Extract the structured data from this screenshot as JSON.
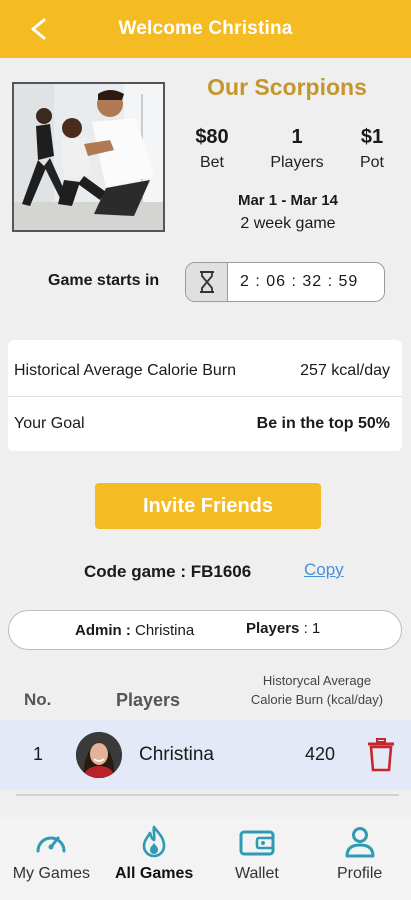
{
  "header": {
    "title": "Welcome Christina",
    "back_icon": "chevron-left-icon"
  },
  "game": {
    "title": "Our Scorpions",
    "stats": [
      {
        "value": "$80",
        "label": "Bet"
      },
      {
        "value": "1",
        "label": "Players"
      },
      {
        "value": "$1",
        "label": "Pot"
      }
    ],
    "dates": "Mar 1 - Mar 14",
    "duration": "2 week game",
    "starts_label": "Game starts in",
    "countdown": "2 : 06 : 32 : 59"
  },
  "info": {
    "avg_label": "Historical Average Calorie Burn",
    "avg_value": "257 kcal/day",
    "goal_label": "Your Goal",
    "goal_value": "Be in the top 50%"
  },
  "invite": {
    "label": "Invite Friends"
  },
  "code": {
    "label": "Code game : FB1606",
    "copy": "Copy"
  },
  "admin": {
    "admin_label": "Admin :",
    "admin_name": "Christina",
    "players_label": "Players",
    "players_value": ": 1"
  },
  "table": {
    "headers": {
      "no": "No.",
      "players": "Players",
      "avg_line1": "Historycal Average",
      "avg_line2": "Calorie Burn (kcal/day)"
    },
    "rows": [
      {
        "no": "1",
        "name": "Christina",
        "value": "420"
      }
    ]
  },
  "nav": {
    "items": [
      {
        "label": "My Games",
        "icon": "speedometer-icon"
      },
      {
        "label": "All Games",
        "icon": "flame-icon",
        "active": true
      },
      {
        "label": "Wallet",
        "icon": "wallet-icon"
      },
      {
        "label": "Profile",
        "icon": "user-icon"
      }
    ]
  },
  "colors": {
    "accent": "#f5bb22",
    "title_gold": "#c4962b",
    "nav_teal": "#2f9bb2",
    "delete_red": "#c8262b",
    "link_blue": "#4a90d9",
    "row_highlight": "#e4e9f7"
  }
}
